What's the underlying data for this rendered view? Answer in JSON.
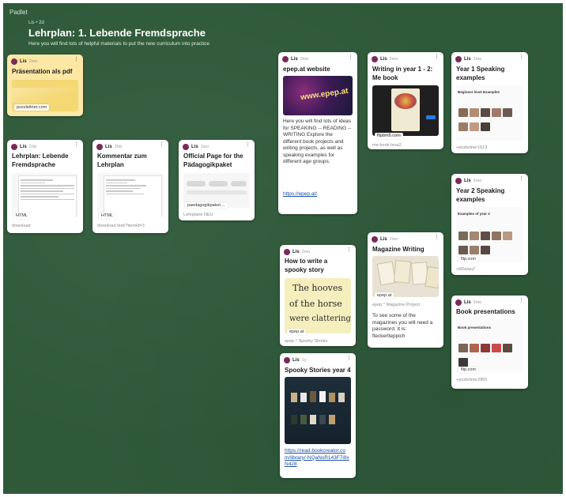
{
  "app": {
    "brand": "Padlet"
  },
  "header": {
    "meta": "Lis • 2d",
    "title": "Lehrplan: 1. Lebende Fremdsprache",
    "description": "Here you will find lots of helpful materials to put the new curriculum into practice"
  },
  "author": "Lis",
  "cards": {
    "praes": {
      "age": "2mo",
      "title": "Präsentation als pdf",
      "chip": "pozzleitner.com"
    },
    "lehrplan": {
      "age": "20d",
      "title": "Lehrplan: Lebende Fremdsprache",
      "chip": "HTML",
      "source": "download"
    },
    "kommentar": {
      "age": "20d",
      "title": "Kommentar zum Lehrplan",
      "chip": "HTML",
      "source": "download.html?itemId=3"
    },
    "official": {
      "age": "1mo",
      "title": "Official Page for the Pädagogikpaket",
      "chip": "paedagogikpaket....",
      "source": "Lehrpläne NEU"
    },
    "epep": {
      "age": "2mo",
      "title": "epep.at website",
      "thumb_text": "www.epep.at",
      "body": "Here you will find lots of ideas for SPEAKING -- READING -- WRITING Explore the different book projects and writing projects, as well as speaking examples for different age groups.",
      "link": "https://epep.at/"
    },
    "writing": {
      "age": "2mo",
      "title": "Writing in year 1 - 2: Me book",
      "chip": "flipbm5.com",
      "source": "me-book-lena2"
    },
    "year1": {
      "age": "2mo",
      "title": "Year 1 Speaking examples",
      "thumb_heading": "Beginner level Examples",
      "chip": "flip.com",
      "source": "+pozleitner1613"
    },
    "year2": {
      "age": "2mo",
      "title": "Year 2 Speaking examples",
      "thumb_heading": "Examples of year 2",
      "chip": "flip.com",
      "source": "+60lalaq7"
    },
    "spooky": {
      "age": "2mo",
      "title": "How to write a spooky story",
      "hand_lines": [
        "The hooves",
        "of the horse",
        "were clattering"
      ],
      "chip": "epep.at",
      "source": "epep ° Spooky Stories"
    },
    "magazine": {
      "age": "2mo",
      "title": "Magazine Writing",
      "chip": "epep.at",
      "source": "epep ° Magazine Project",
      "body": "To see some of the magazines you will need a password. It is: fleckerlteppich"
    },
    "book": {
      "age": "2mo",
      "title": "Book presentations",
      "thumb_heading": "Book presentations",
      "chip": "flip.com",
      "source": "+pozleitner2850"
    },
    "spookyyear4": {
      "age": "1y",
      "title": "Spooky Stories year 4",
      "link": "https://read.bookcreator.com/library/-NQaNsR143F7i9xN428"
    }
  },
  "colors": {
    "board": "#2f5a3a",
    "note_yellow": "#fde7a5",
    "avatar": "#7a2a58",
    "link": "#1a4fa0"
  }
}
